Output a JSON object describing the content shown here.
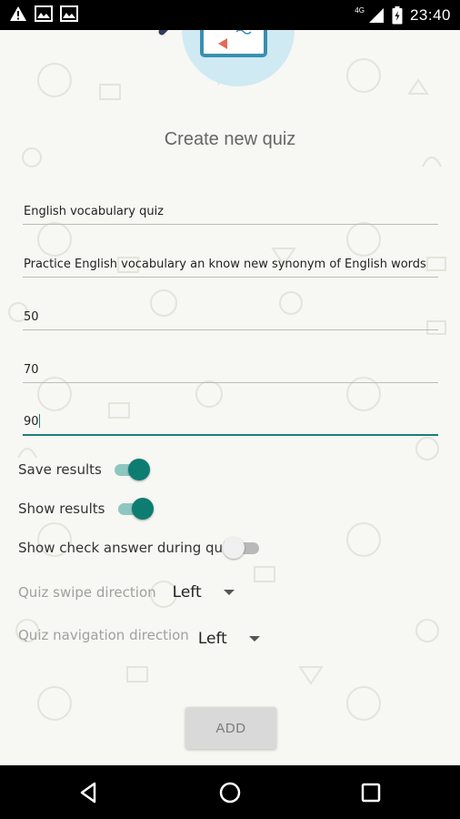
{
  "status_bar": {
    "network_tag": "4G",
    "time": "23:40",
    "icons": [
      "warning-icon",
      "image-icon",
      "image-icon",
      "signal-icon",
      "battery-icon"
    ]
  },
  "page": {
    "title": "Create new quiz"
  },
  "form": {
    "quiz_name": "English vocabulary quiz",
    "quiz_description": "Practice English vocabulary an know new synonym of English words",
    "field_3": "50",
    "field_4": "70",
    "field_5": "90"
  },
  "switches": {
    "save_results": {
      "label": "Save results",
      "on": true
    },
    "show_results": {
      "label": "Show results",
      "on": true
    },
    "show_check_answer": {
      "label": "Show check answer during quiz",
      "on": false
    }
  },
  "selects": {
    "swipe_direction": {
      "label": "Quiz swipe direction",
      "value": "Left"
    },
    "navigation_direction": {
      "label": "Quiz navigation direction",
      "value": "Left"
    }
  },
  "actions": {
    "add_label": "ADD"
  },
  "colors": {
    "accent": "#0d7d71",
    "accent_light": "#8ec7c1",
    "status_bar": "#000000",
    "background": "#f7f7f3"
  }
}
